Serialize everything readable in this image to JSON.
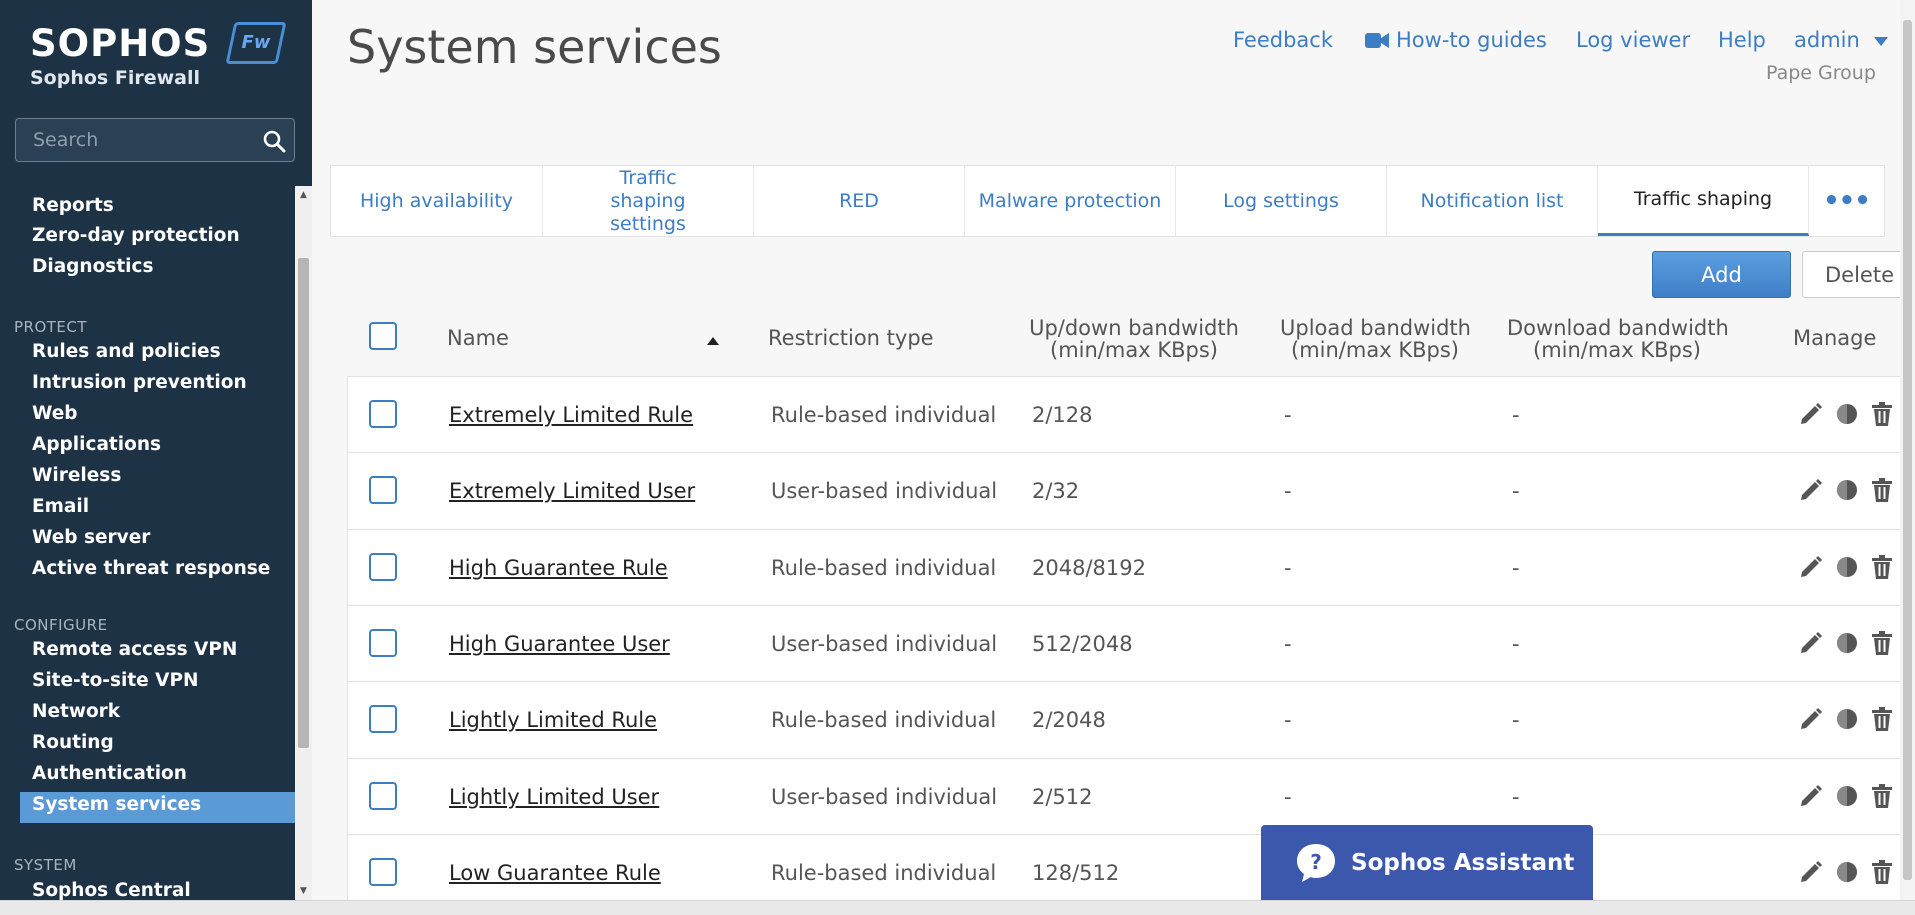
{
  "brand": {
    "name": "SOPHOS",
    "badge": "Fw",
    "product": "Sophos Firewall"
  },
  "search": {
    "placeholder": "Search"
  },
  "nav": {
    "items_top": [
      "Reports",
      "Zero-day protection",
      "Diagnostics"
    ],
    "protect_label": "PROTECT",
    "protect_items": [
      "Rules and policies",
      "Intrusion prevention",
      "Web",
      "Applications",
      "Wireless",
      "Email",
      "Web server",
      "Active threat response"
    ],
    "configure_label": "CONFIGURE",
    "configure_items": [
      "Remote access VPN",
      "Site-to-site VPN",
      "Network",
      "Routing",
      "Authentication",
      "System services"
    ],
    "system_label": "SYSTEM",
    "system_items": [
      "Sophos Central"
    ],
    "active": "System services"
  },
  "header": {
    "title": "System services",
    "links": {
      "feedback": "Feedback",
      "howto": "How-to guides",
      "log_viewer": "Log viewer",
      "help": "Help",
      "user": "admin"
    },
    "org": "Pape Group"
  },
  "tabs": [
    {
      "label": "High availability"
    },
    {
      "label": "Traffic shaping settings"
    },
    {
      "label": "RED"
    },
    {
      "label": "Malware protection"
    },
    {
      "label": "Log settings"
    },
    {
      "label": "Notification list"
    },
    {
      "label": "Traffic shaping",
      "active": true
    }
  ],
  "actions": {
    "add": "Add",
    "delete": "Delete"
  },
  "table": {
    "columns": {
      "name": "Name",
      "restriction": "Restriction type",
      "updown": "Up/down bandwidth",
      "updown_sub": "(min/max KBps)",
      "upload": "Upload bandwidth",
      "upload_sub": "(min/max KBps)",
      "download": "Download bandwidth",
      "download_sub": "(min/max KBps)",
      "manage": "Manage"
    },
    "rows": [
      {
        "name": "Extremely Limited Rule",
        "restriction": "Rule-based individual",
        "updown": "2/128",
        "upload": "-",
        "download": "-"
      },
      {
        "name": "Extremely Limited User",
        "restriction": "User-based individual",
        "updown": "2/32",
        "upload": "-",
        "download": "-"
      },
      {
        "name": "High Guarantee Rule",
        "restriction": "Rule-based individual",
        "updown": "2048/8192",
        "upload": "-",
        "download": "-"
      },
      {
        "name": "High Guarantee User",
        "restriction": "User-based individual",
        "updown": "512/2048",
        "upload": "-",
        "download": "-"
      },
      {
        "name": "Lightly Limited Rule",
        "restriction": "Rule-based individual",
        "updown": "2/2048",
        "upload": "-",
        "download": "-"
      },
      {
        "name": "Lightly Limited User",
        "restriction": "User-based individual",
        "updown": "2/512",
        "upload": "-",
        "download": "-"
      },
      {
        "name": "Low Guarantee Rule",
        "restriction": "Rule-based individual",
        "updown": "128/512",
        "upload": "",
        "download": ""
      }
    ]
  },
  "assistant": {
    "label": "Sophos Assistant"
  },
  "colors": {
    "sidebar": "#1d3245",
    "accent": "#3d7dc4",
    "active_nav": "#5a9ad6",
    "assistant": "#3c58ad"
  },
  "icons": [
    "search-icon",
    "camera-icon",
    "caret-down-icon",
    "edit-icon",
    "toggle-icon",
    "trash-icon",
    "question-bubble-icon",
    "more-icon",
    "sort-asc-icon"
  ]
}
